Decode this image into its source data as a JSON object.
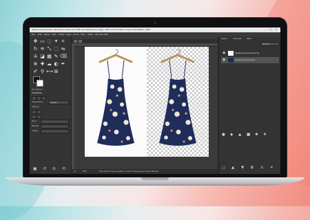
{
  "window": {
    "title": "lipsake-img-tinmimalis-1-58-108 (Converted 16.2 MSE color RGB gamma integer, 1860 multi 19:150/1) 2 layers 1674.0/9041 - GIMP",
    "controls": {
      "minimize": "–",
      "maximize": "□",
      "close": "✕"
    }
  },
  "menubar": [
    "File",
    "Edit",
    "Select",
    "View",
    "Image",
    "Layer",
    "Colors",
    "Tools",
    "Filters",
    "Windows",
    "Help"
  ],
  "toolbox": {
    "tool_icons": [
      "move-icon",
      "rect-select-icon",
      "lasso-icon",
      "fuzzy-select-icon",
      "crop-icon",
      "rotate-icon",
      "warp-icon",
      "transform-icon",
      "perspective-icon",
      "flip-icon",
      "text-icon",
      "bucket-fill-icon",
      "gradient-icon",
      "paintbrush-icon",
      "eraser-icon",
      "clone-icon",
      "heal-icon",
      "smudge-icon",
      "dodge-icon",
      "path-icon",
      "eyedropper-icon",
      "zoom-icon",
      "measure-icon",
      "align-icon"
    ],
    "tool_glyphs": [
      "✥",
      "▭",
      "◌",
      "✦",
      "⌗",
      "↻",
      "≋",
      "⤡",
      "⬚",
      "⇋",
      "A",
      "◪",
      "▦",
      "✎",
      "⌫",
      "⊕",
      "✚",
      "☁",
      "◐",
      "✒",
      "✐",
      "⚲",
      "⟷",
      "⊞"
    ],
    "options_title": "Tool Options",
    "options_header": "Transform",
    "opt_label_a": "Interpolation",
    "opt_value_a": "Images",
    "opt_label_b": "Clipping",
    "opt_label_c": "Show",
    "opt_label_d": "Preview",
    "opt_label_e": "Guides",
    "bottom_icons": [
      "save-icon",
      "restore-icon",
      "delete-icon",
      "reset-icon"
    ],
    "bottom_glyphs": [
      "▣",
      "↺",
      "⊘",
      "⟲"
    ]
  },
  "canvas": {
    "status_text": "Click-Drag to draw a guide, or click to Show drag to move the hint",
    "unit": "px",
    "zoom": "25%"
  },
  "dock": {
    "tabs": [
      "Layers",
      "Channels",
      "Paths"
    ],
    "mode_label": "Normal",
    "layers": [
      {
        "name": "lipsake-img-transparent-bg"
      },
      {
        "name": "lipsake-img-tinmimalis"
      }
    ],
    "bottom_icons": [
      "new-layer-icon",
      "raise-icon",
      "lower-icon",
      "duplicate-icon",
      "anchor-icon",
      "delete-layer-icon"
    ],
    "bottom_glyphs": [
      "▢",
      "▲",
      "▼",
      "⧉",
      "⚓",
      "✕"
    ],
    "brush_icons": [
      "brush-1-icon",
      "brush-2-icon",
      "brush-3-icon",
      "brush-4-icon",
      "brush-5-icon",
      "brush-6-icon"
    ],
    "brush_glyphs": [
      "●",
      "◆",
      "▲",
      "■",
      "✱",
      "❖"
    ]
  },
  "colors": {
    "accent": "#3b74c4",
    "dress": "#1f2d5a"
  }
}
